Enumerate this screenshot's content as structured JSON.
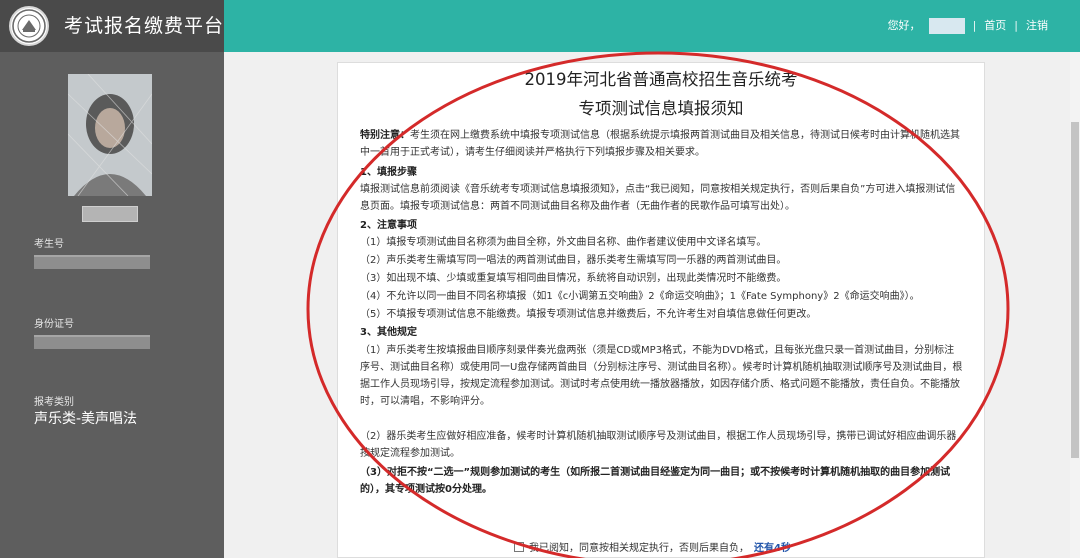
{
  "header": {
    "app_title": "考试报名缴费平台",
    "greeting": "您好，",
    "separator": "|",
    "home_label": "首页",
    "logout_label": "注销"
  },
  "profile": {
    "exam_no_label": "考生号",
    "id_no_label": "身份证号",
    "category_label": "报考类别",
    "category_value": "声乐类-美声唱法"
  },
  "notice": {
    "title_line1": "2019年河北省普通高校招生音乐统考",
    "title_line2": "专项测试信息填报须知",
    "special_label": "特别注意：",
    "special_text": "考生须在网上缴费系统中填报专项测试信息（根据系统提示填报两首测试曲目及相关信息，待测试日候考时由计算机随机选其中一首用于正式考试），请考生仔细阅读并严格执行下列填报步骤及相关要求。",
    "section1_title": "1、填报步骤",
    "section1_text": "填报测试信息前须阅读《音乐统考专项测试信息填报须知》，点击“我已阅知，同意按相关规定执行，否则后果自负”方可进入填报测试信息页面。填报专项测试信息：两首不同测试曲目名称及曲作者（无曲作者的民歌作品可填写出处）。",
    "section2_title": "2、注意事项",
    "section2_item1": "（1）填报专项测试曲目名称须为曲目全称，外文曲目名称、曲作者建议使用中文译名填写。",
    "section2_item2": "（2）声乐类考生需填写同一唱法的两首测试曲目，器乐类考生需填写同一乐器的两首测试曲目。",
    "section2_item3": "（3）如出现不填、少填或重复填写相同曲目情况，系统将自动识别，出现此类情况时不能缴费。",
    "section2_item4": "（4）不允许以同一曲目不同名称填报（如1《c小调第五交响曲》2《命运交响曲》；1《Fate Symphony》2《命运交响曲》）。",
    "section2_item5": "（5）不填报专项测试信息不能缴费。填报专项测试信息并缴费后，不允许考生对自填信息做任何更改。",
    "section3_title": "3、其他规定",
    "section3_item1": "（1）声乐类考生按填报曲目顺序刻录伴奏光盘两张（须是CD或MP3格式，不能为DVD格式，且每张光盘只录一首测试曲目，分别标注序号、测试曲目名称）或使用同一U盘存储两首曲目（分别标注序号、测试曲目名称）。候考时计算机随机抽取测试顺序号及测试曲目，根据工作人员现场引导，按规定流程参加测试。测试时考点使用统一播放器播放，如因存储介质、格式问题不能播放，责任自负。不能播放时，可以清唱，不影响评分。",
    "section3_item2": "（2）器乐类考生应做好相应准备，候考时计算机随机抽取测试顺序号及测试曲目，根据工作人员现场引导，携带已调试好相应曲调乐器按规定流程参加测试。",
    "section3_item3": "（3）对拒不按“二选一”规则参加测试的考生（如所报二首测试曲目经鉴定为同一曲目；或不按候考时计算机随机抽取的曲目参加测试的），其专项测试按0分处理。",
    "agree_text": "我已阅知，同意按相关规定执行，否则后果自负，",
    "countdown": "还有4秒"
  },
  "colors": {
    "header_teal": "#2db3a5",
    "brand_dark": "#4a4a4a",
    "sidebar_gray": "#5e5e5e",
    "annotation_red": "#d42a2a",
    "countdown_blue": "#2255aa"
  },
  "icons": {
    "logo": "school-seal-icon"
  }
}
